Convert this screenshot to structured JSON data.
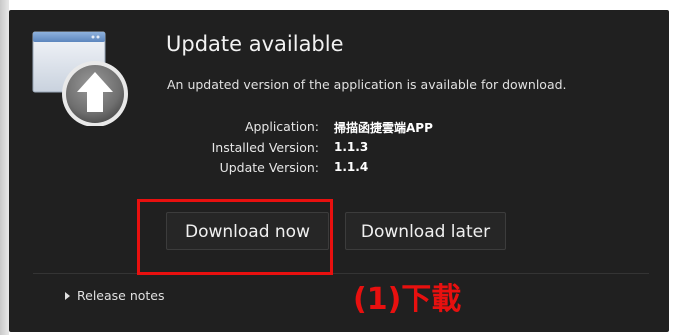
{
  "dialog": {
    "title": "Update available",
    "message": "An updated version of the application is available for download.",
    "info": [
      {
        "label": "Application:",
        "value": "掃描函捷雲端APP"
      },
      {
        "label": "Installed Version:",
        "value": "1.1.3"
      },
      {
        "label": "Update Version:",
        "value": "1.1.4"
      }
    ],
    "buttons": {
      "download_now": "Download now",
      "download_later": "Download later"
    },
    "release_notes": "Release notes"
  },
  "annotation": {
    "text": "(1)下載",
    "color": "#e8100f"
  },
  "icons": {
    "app_icon": "update-app-icon",
    "expand": "triangle-right-icon"
  }
}
